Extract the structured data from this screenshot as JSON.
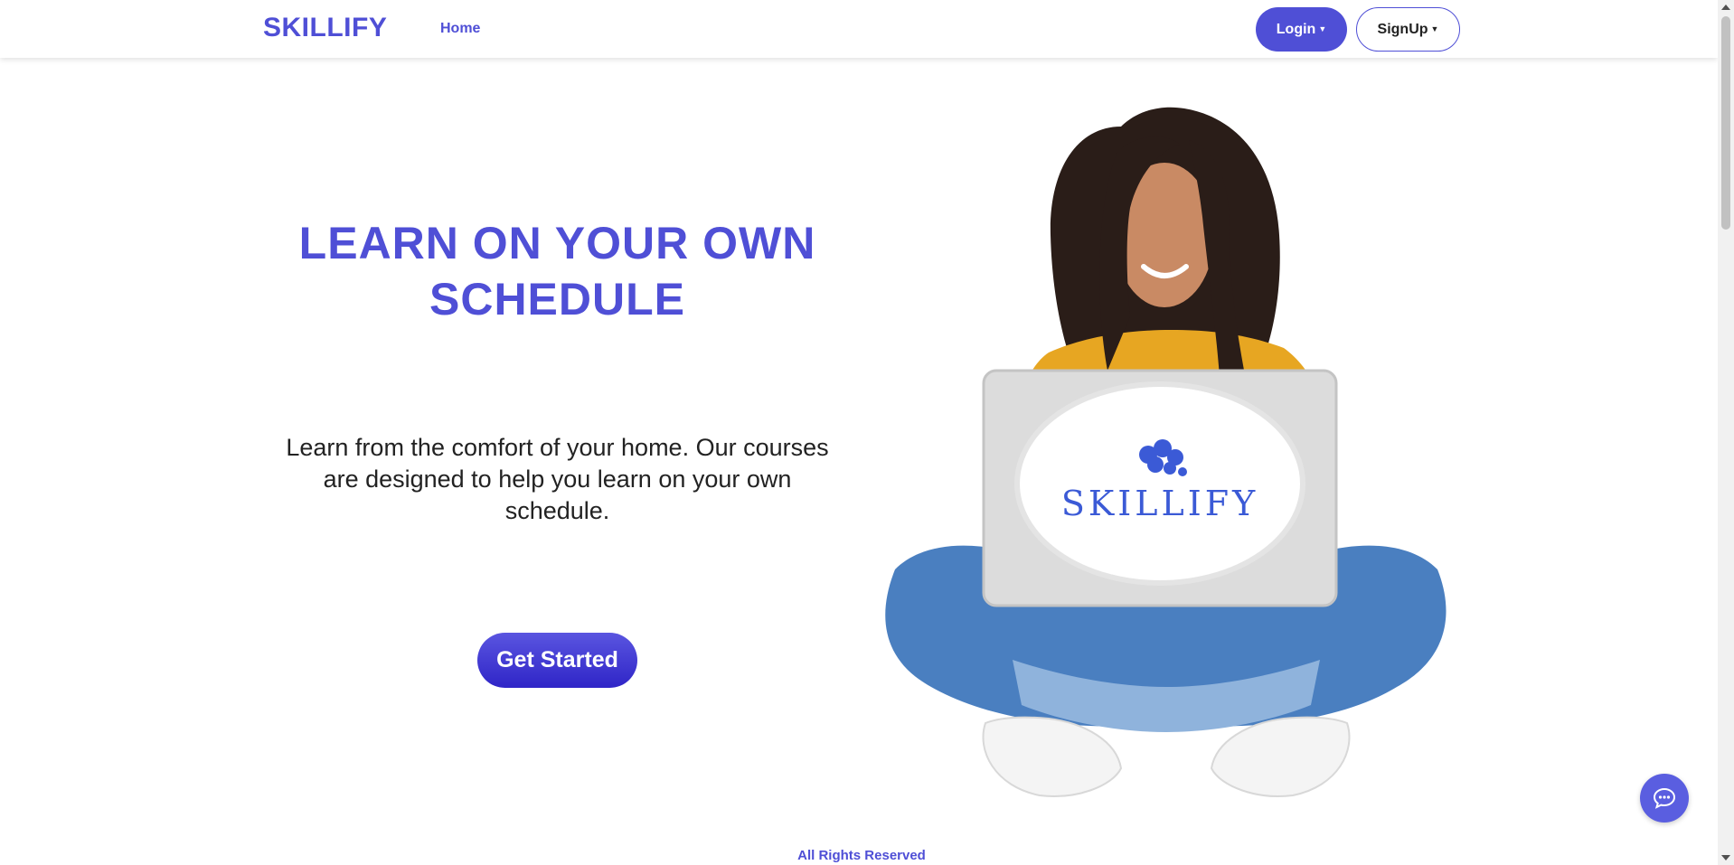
{
  "header": {
    "brand": "SKILLIFY",
    "nav_home": "Home",
    "login_label": "Login",
    "signup_label": "SignUp"
  },
  "hero": {
    "title": "LEARN ON YOUR OWN SCHEDULE",
    "text": "Learn from the comfort of your home. Our courses are designed to help you learn on your own schedule.",
    "cta_label": "Get Started",
    "laptop_logo_text": "SKILLIFY"
  },
  "footer": {
    "text": "All Rights Reserved"
  },
  "colors": {
    "accent": "#4f4fd6",
    "button_gradient_end": "#2f25c7",
    "chat_button": "#5a5ee0"
  },
  "icons": [
    "chat-bubble-icon",
    "caret-down-icon"
  ]
}
